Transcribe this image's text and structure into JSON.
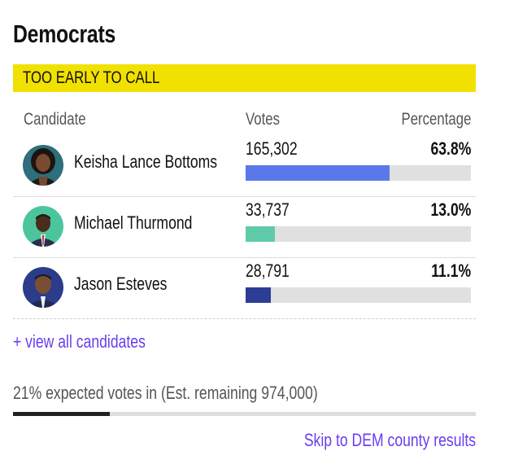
{
  "section": {
    "title": "Democrats",
    "status": "TOO EARLY TO CALL",
    "status_color": "#f1e100"
  },
  "table": {
    "headers": {
      "candidate": "Candidate",
      "votes": "Votes",
      "percentage": "Percentage"
    },
    "rows": [
      {
        "name": "Keisha Lance Bottoms",
        "votes": "165,302",
        "pct": "63.8%",
        "share": 0.638,
        "color": "#5b78ea",
        "avatar": "avatar-photo-keisha"
      },
      {
        "name": "Michael Thurmond",
        "votes": "33,737",
        "pct": "13.0%",
        "share": 0.13,
        "color": "#5fcba8",
        "avatar": "avatar-photo-michael"
      },
      {
        "name": "Jason Esteves",
        "votes": "28,791",
        "pct": "11.1%",
        "share": 0.111,
        "color": "#2c3d96",
        "avatar": "avatar-photo-jason"
      }
    ]
  },
  "links": {
    "view_all": "+ view all candidates",
    "skip": "Skip to DEM county results",
    "link_color": "#6a3df0"
  },
  "expected": {
    "text": "21% expected votes in (Est. remaining 974,000)",
    "fraction": 0.21
  }
}
